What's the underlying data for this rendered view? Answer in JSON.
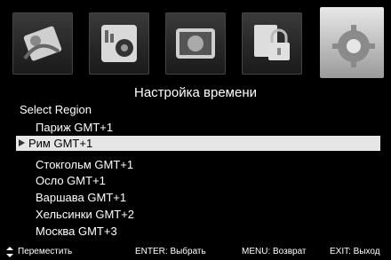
{
  "icons": [
    {
      "name": "picture-settings-icon"
    },
    {
      "name": "sound-settings-icon"
    },
    {
      "name": "channel-settings-icon"
    },
    {
      "name": "lock-settings-icon"
    },
    {
      "name": "system-settings-icon"
    }
  ],
  "menu": {
    "title": "Настройка времени",
    "section_label": "Select Region",
    "items": [
      "Париж GMT+1",
      "Рим GMT+1",
      "Стокгольм GMT+1",
      "Осло GMT+1",
      "Варшава GMT+1",
      "Хельсинки GMT+2",
      "Москва GMT+3"
    ],
    "selected_index": 1
  },
  "footer": {
    "nav_icon": "up-down-arrow-icon",
    "move": "Переместить",
    "enter": "ENTER: Выбрать",
    "menu": "MENU: Возврат",
    "exit": "EXIT: Выход"
  }
}
